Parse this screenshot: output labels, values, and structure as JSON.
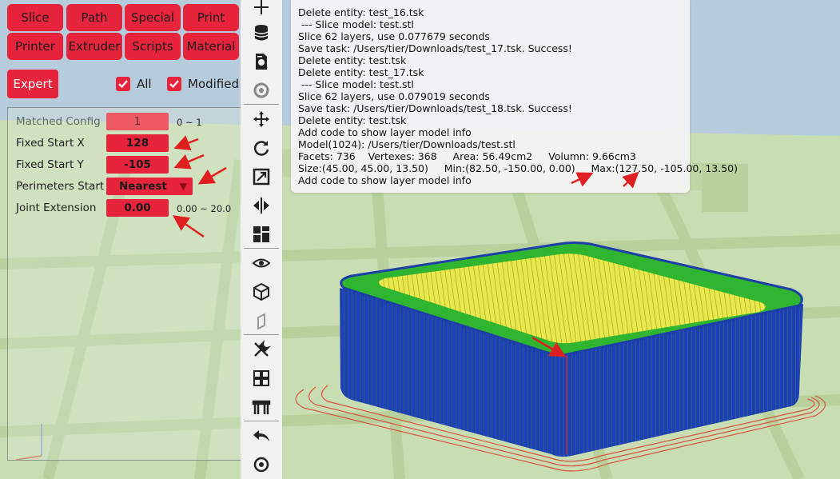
{
  "tabs_row1": [
    "Slice",
    "Path",
    "Special",
    "Print"
  ],
  "tabs_row2": [
    "Printer",
    "Extruder",
    "Scripts",
    "Material"
  ],
  "expert_label": "Expert",
  "filters": {
    "all_label": "All",
    "modified_label": "Modified",
    "all_checked": true,
    "modified_checked": true
  },
  "settings": {
    "matched_config": {
      "label": "Matched Config",
      "value": "1",
      "range": "0 ~ 1"
    },
    "fixed_start_x": {
      "label": "Fixed Start X",
      "value": "128"
    },
    "fixed_start_y": {
      "label": "Fixed Start Y",
      "value": "-105"
    },
    "perimeters_start": {
      "label": "Perimeters Start",
      "value": "Nearest"
    },
    "joint_extension": {
      "label": "Joint Extension",
      "value": "0.00",
      "range": "0.00 ~ 20.0"
    }
  },
  "toolbar": [
    "add-icon",
    "database-icon",
    "search-file-icon",
    "filament-icon",
    "move-icon",
    "rotate-icon",
    "scale-icon",
    "mirror-icon",
    "layout-icon",
    "visibility-icon",
    "cube-view-icon",
    "side-view-icon",
    "tools-icon",
    "grid-icon",
    "bridge-icon",
    "undo-icon",
    "reset-view-icon"
  ],
  "log": [
    "Delete entity: test_16.tsk",
    " --- Slice model: test.stl",
    "Slice 62 layers, use 0.077679 seconds",
    "Save task: /Users/tier/Downloads/test_17.tsk. Success!",
    "Delete entity: test.tsk",
    "Delete entity: test_17.tsk",
    " --- Slice model: test.stl",
    "Slice 62 layers, use 0.079019 seconds",
    "Save task: /Users/tier/Downloads/test_18.tsk. Success!",
    "Delete entity: test.tsk",
    "Add code to show layer model info",
    "Model(1024): /Users/tier/Downloads/test.stl",
    "Facets: 736    Vertexes: 368     Area: 56.49cm2     Volumn: 9.66cm3",
    "Size:(45.00, 45.00, 13.50)     Min:(82.50, -150.00, 0.00)     Max:(127.50, -105.00, 13.50)",
    "Add code to show layer model info"
  ],
  "colors": {
    "accent": "#e8243c",
    "bed_green": "#c7dcb0",
    "model_blue": "#1f3fb8",
    "model_green": "#2eb82e",
    "model_yellow": "#f0f03a"
  }
}
